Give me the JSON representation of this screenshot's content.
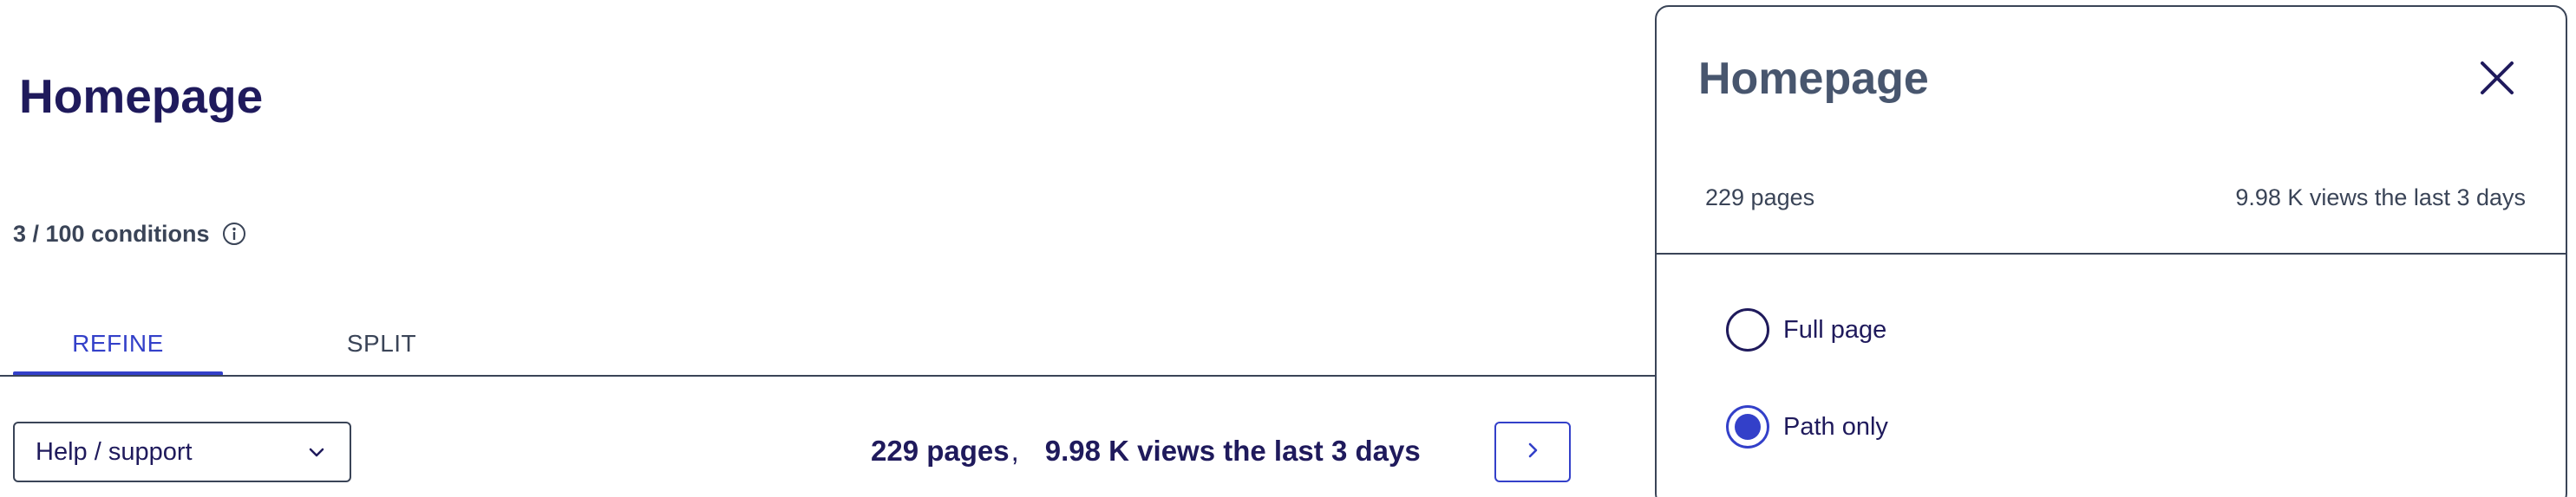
{
  "main": {
    "title": "Homepage",
    "conditions": "3 / 100 conditions",
    "tabs": [
      {
        "label": "REFINE",
        "active": true
      },
      {
        "label": "SPLIT",
        "active": false
      }
    ],
    "select": {
      "value": "Help / support"
    },
    "summary": {
      "pages": "229 pages",
      "separator": ",",
      "views": "9.98 K views the last 3 days"
    }
  },
  "panel": {
    "title": "Homepage",
    "pages": "229 pages",
    "views": "9.98 K views the last 3 days",
    "options": [
      {
        "label": "Full page",
        "selected": false
      },
      {
        "label": "Path only",
        "selected": true
      }
    ]
  },
  "colors": {
    "accent": "#3340c9",
    "title": "#1f1a5c",
    "text_secondary": "#3a4457",
    "panel_title": "#48566e"
  },
  "icons": {
    "info": "info-icon",
    "chevron_down": "chevron-down-icon",
    "next": "chevron-right-icon",
    "close": "close-icon"
  }
}
